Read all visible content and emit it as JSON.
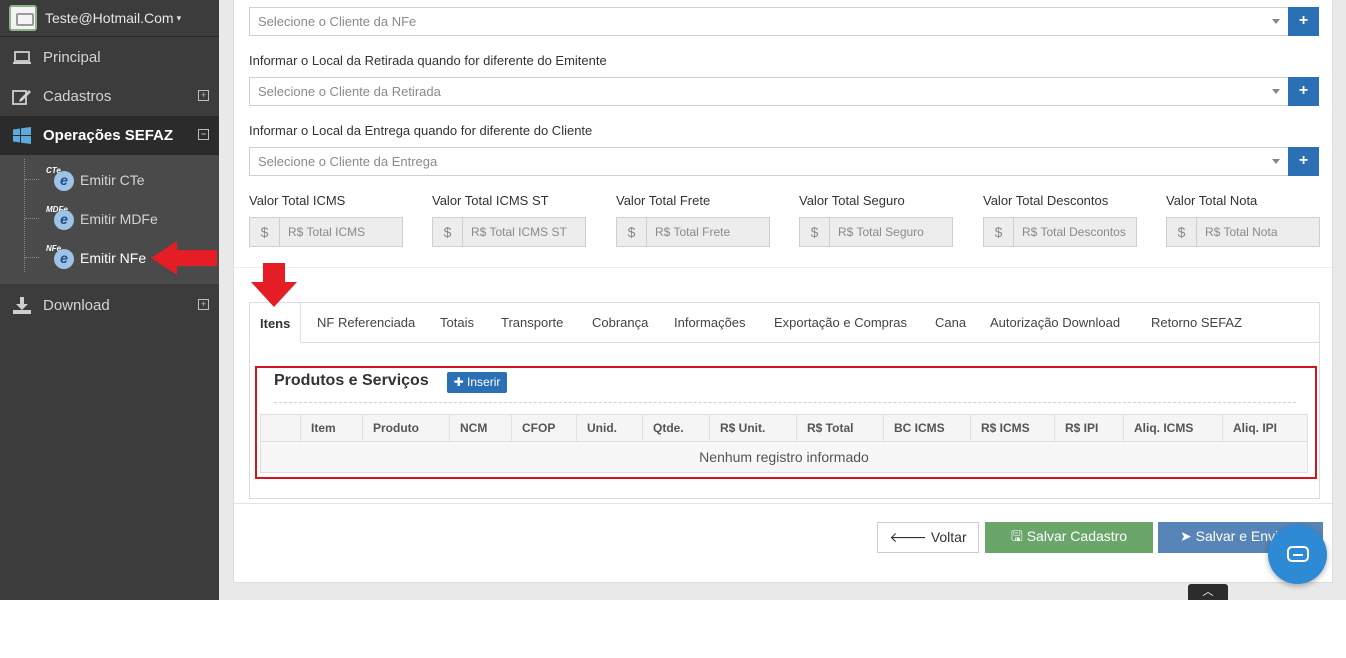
{
  "user": {
    "name": "Teste@Hotmail.Com",
    "caret": "⌄"
  },
  "nav": [
    {
      "label": "Principal",
      "icon": "laptop-icon"
    },
    {
      "label": "Cadastros",
      "icon": "edit-icon",
      "expander": "⊞"
    },
    {
      "label": "Operações SEFAZ",
      "icon": "windows-icon",
      "expander": "⊟"
    },
    {
      "label": "Download",
      "icon": "download-icon",
      "expander": "⊞"
    }
  ],
  "subnav": [
    {
      "tag": "CTe",
      "label": "Emitir CTe"
    },
    {
      "tag": "MDFe",
      "label": "Emitir MDFe"
    },
    {
      "tag": "NFe",
      "label": "Emitir NFe"
    }
  ],
  "form": {
    "client_placeholder": "Selecione o Cliente da NFe",
    "retirada_label": "Informar o Local da Retirada quando for diferente do Emitente",
    "retirada_placeholder": "Selecione o Cliente da Retirada",
    "entrega_label": "Informar o Local da Entrega quando for diferente do Cliente",
    "entrega_placeholder": "Selecione o Cliente da Entrega",
    "plus": "+"
  },
  "totals": [
    {
      "label": "Valor Total ICMS",
      "placeholder": "R$ Total ICMS"
    },
    {
      "label": "Valor Total ICMS ST",
      "placeholder": "R$ Total ICMS ST"
    },
    {
      "label": "Valor Total Frete",
      "placeholder": "R$ Total Frete"
    },
    {
      "label": "Valor Total Seguro",
      "placeholder": "R$ Total Seguro"
    },
    {
      "label": "Valor Total Descontos",
      "placeholder": "R$ Total Descontos"
    },
    {
      "label": "Valor Total Nota",
      "placeholder": "R$ Total Nota"
    }
  ],
  "currency_symbol": "$",
  "tabs": [
    "Itens",
    "NF Referenciada",
    "Totais",
    "Transporte",
    "Cobrança",
    "Informações",
    "Exportação e Compras",
    "Cana",
    "Autorização Download",
    "Retorno SEFAZ"
  ],
  "products": {
    "title": "Produtos e Serviços",
    "insert_label": "Inserir",
    "columns": [
      "Item",
      "Produto",
      "NCM",
      "CFOP",
      "Unid.",
      "Qtde.",
      "R$ Unit.",
      "R$ Total",
      "BC ICMS",
      "R$ ICMS",
      "R$ IPI",
      "Aliq. ICMS",
      "Aliq. IPI"
    ],
    "empty_message": "Nenhum registro informado"
  },
  "buttons": {
    "back": "Voltar",
    "save": "Salvar Cadastro",
    "send": "Salvar e Enviar"
  },
  "colors": {
    "primary": "#2b6fb5",
    "save": "#6aa66a",
    "send": "#5885b7",
    "highlight": "#d4141e",
    "sidebar": "#3c3c3c"
  }
}
